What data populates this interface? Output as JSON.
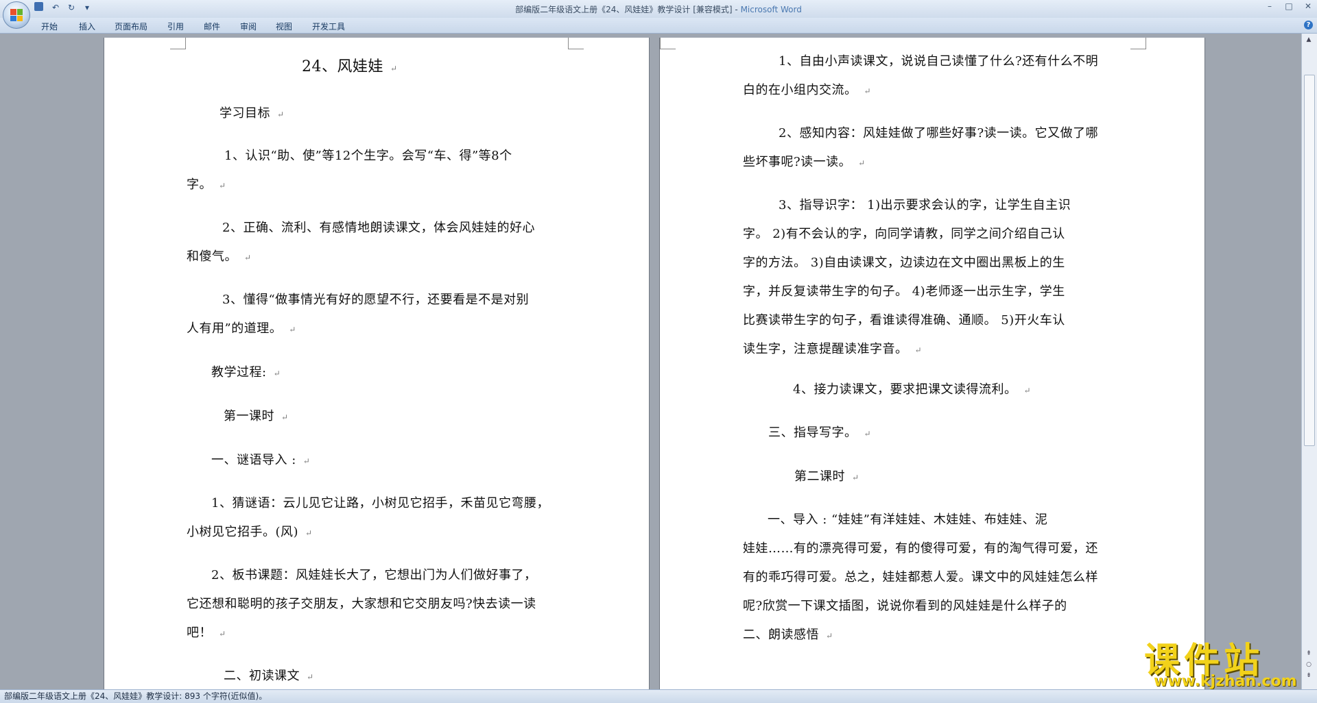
{
  "window": {
    "title": "部编版二年级语文上册《24、风娃娃》教学设计 [兼容模式] - ",
    "app_name": "Microsoft Word"
  },
  "quick_access": {
    "save_icon": "save-icon",
    "undo_glyph": "↶",
    "redo_glyph": "↻",
    "customize_glyph": "▾"
  },
  "window_controls": {
    "minimize": "–",
    "maximize": "□",
    "close": "✕"
  },
  "ribbon": {
    "tabs": [
      "开始",
      "插入",
      "页面布局",
      "引用",
      "邮件",
      "审阅",
      "视图",
      "开发工具"
    ],
    "help": "?"
  },
  "document": {
    "left_page": {
      "title": "24、风娃娃",
      "paragraphs": [
        [
          "学习目标"
        ],
        [
          "1、认识“助、使”等12个生字。会写“车、得”等8个",
          "字。"
        ],
        [
          "2、正确、流利、有感情地朗读课文，体会风娃娃的好心",
          "和傻气。"
        ],
        [
          "3、懂得“做事情光有好的愿望不行，还要看是不是对别",
          "人有用”的道理。"
        ],
        [
          "教学过程:"
        ],
        [
          "第一课时"
        ],
        [
          "一、谜语导入 :"
        ],
        [
          "1、猜谜语：云儿见它让路，小树见它招手，禾苗见它弯腰，",
          "小树见它招手。(风)"
        ],
        [
          "2、板书课题：风娃娃长大了，它想出门为人们做好事了，",
          "它还想和聪明的孩子交朋友，大家想和它交朋友吗?快去读一读",
          "吧！"
        ],
        [
          "二、初读课文"
        ]
      ]
    },
    "right_page": {
      "paragraphs": [
        [
          "1、自由小声读课文，说说自己读懂了什么?还有什么不明",
          "白的在小组内交流。"
        ],
        [
          "2、感知内容：风娃娃做了哪些好事?读一读。它又做了哪",
          "些坏事呢?读一读。"
        ],
        [
          "3、指导识字：        1)出示要求会认的字，让学生自主识",
          "字。        2)有不会认的字，向同学请教，同学之间介绍自己认",
          "字的方法。        3)自由读课文，边读边在文中圈出黑板上的生",
          "字，并反复读带生字的句子。        4)老师逐一出示生字，学生",
          "比赛读带生字的句子，看谁读得准确、通顺。        5)开火车认",
          "读生字，注意提醒读准字音。"
        ],
        [
          "4、接力读课文，要求把课文读得流利。"
        ],
        [
          "三、指导写字。"
        ],
        [
          "第二课时"
        ],
        [
          "一、导入 :        “娃娃”有洋娃娃、木娃娃、布娃娃、泥",
          "娃娃……有的漂亮得可爱，有的傻得可爱，有的淘气得可爱，还",
          "有的乖巧得可爱。总之，娃娃都惹人爱。课文中的风娃娃怎么样",
          "呢?欣赏一下课文插图，说说你看到的风娃娃是什么样子的"
        ],
        [
          "二、朗读感悟"
        ]
      ]
    },
    "paragraph_mark": "↵"
  },
  "status_bar": {
    "text": "部编版二年级语文上册《24、风娃娃》教学设计: 893 个字符(近似值)。"
  },
  "watermark": {
    "brand": "课件站",
    "url": "www.kjzhan.com"
  },
  "colors": {
    "workspace": "#9fa6b0",
    "ribbon": "#cfdcec",
    "watermark": "#f2d21a"
  }
}
